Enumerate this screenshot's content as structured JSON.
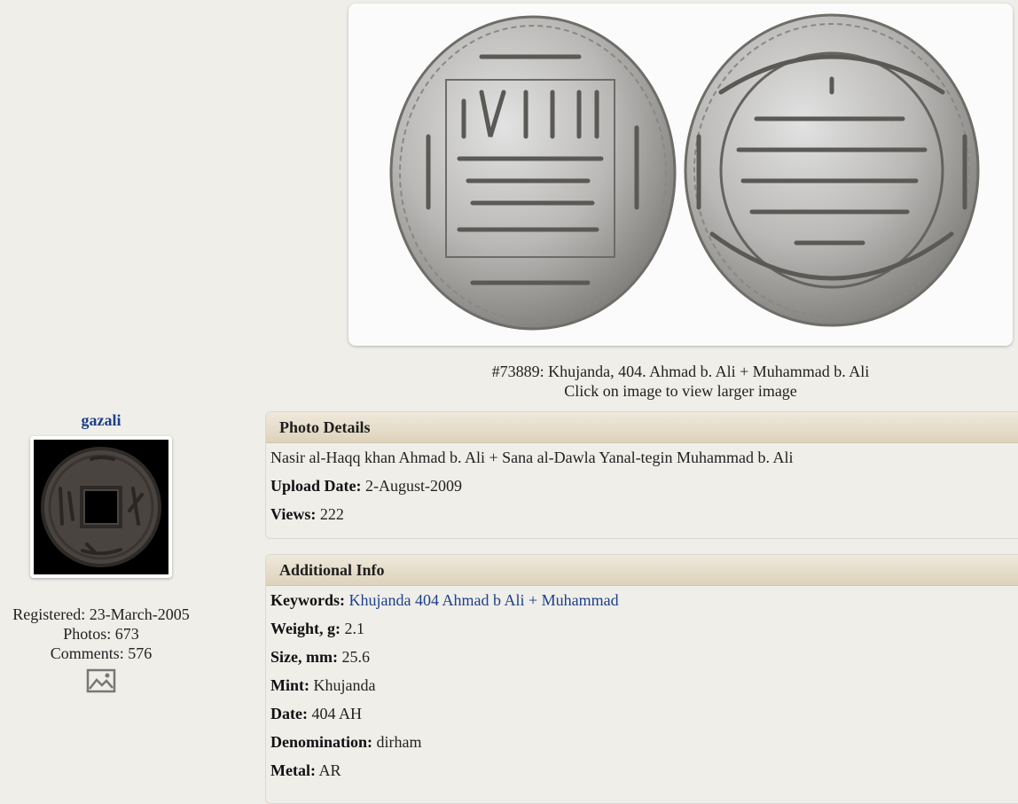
{
  "photo": {
    "caption": "#73889: Khujanda, 404. Ahmad b. Ali + Muhammad b. Ali",
    "hint": "Click on image to view larger image"
  },
  "user": {
    "name": "gazali",
    "registered_label": "Registered:",
    "registered": "23-March-2005",
    "photos_label": "Photos:",
    "photos": "673",
    "comments_label": "Comments:",
    "comments": "576",
    "gallery_icon": "image-gallery-icon"
  },
  "photo_details": {
    "title": "Photo Details",
    "description": "Nasir al-Haqq khan Ahmad b. Ali + Sana al-Dawla Yanal-tegin Muhammad b. Ali",
    "upload_label": "Upload Date:",
    "upload_date": "2-August-2009",
    "views_label": "Views:",
    "views": "222"
  },
  "additional_info": {
    "title": "Additional Info",
    "keywords_label": "Keywords:",
    "keywords": "Khujanda 404 Ahmad b Ali + Muhammad",
    "weight_label": "Weight, g:",
    "weight": "2.1",
    "size_label": "Size, mm:",
    "size": "25.6",
    "mint_label": "Mint:",
    "mint": "Khujanda",
    "date_label": "Date:",
    "date": "404 AH",
    "denomination_label": "Denomination:",
    "denomination": "dirham",
    "metal_label": "Metal:",
    "metal": "AR"
  },
  "colors": {
    "page_bg": "#efeee9",
    "link": "#1b3f8b",
    "panel_header_top": "#efe9dc",
    "panel_header_bottom": "#ddd2bb"
  }
}
